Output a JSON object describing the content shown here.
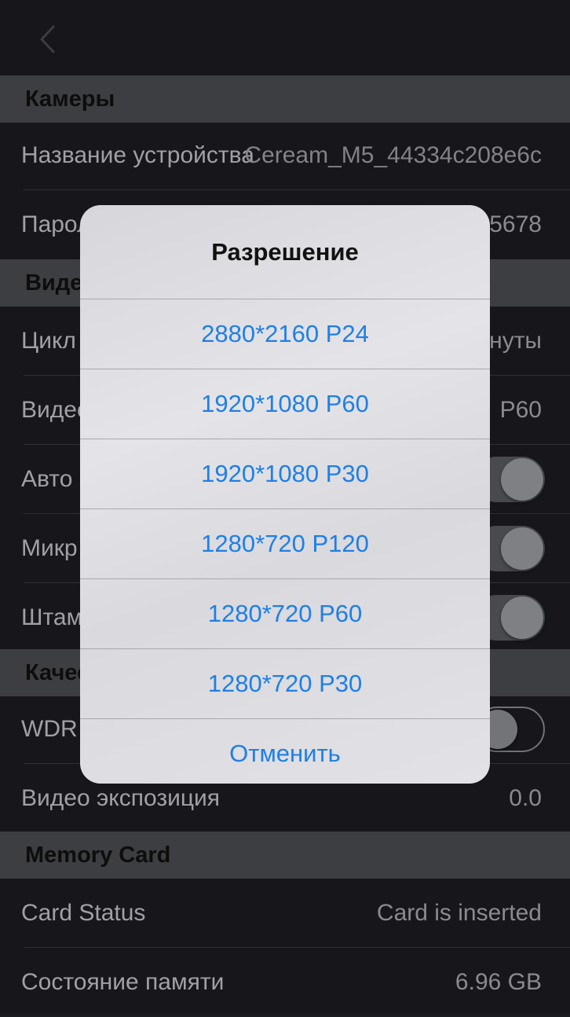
{
  "sections": {
    "camera": "Камеры",
    "video": "Видео",
    "quality": "Качество",
    "memory": "Memory Card"
  },
  "rows": {
    "device_name": {
      "label": "Название устройства",
      "value": "Ceream_M5_44334c208e6c"
    },
    "password": {
      "label": "Пароль",
      "value": "5678"
    },
    "loop": {
      "label": "Цикл",
      "value": "нуты"
    },
    "video_res": {
      "label": "Видео",
      "value": "P60"
    },
    "auto": {
      "label": "Авто"
    },
    "mic": {
      "label": "Микр"
    },
    "stamp": {
      "label": "Штам"
    },
    "wdr": {
      "label": "WDR"
    },
    "exposure": {
      "label": "Видео экспозиция",
      "value": "0.0"
    },
    "card_status": {
      "label": "Card Status",
      "value": "Card is inserted"
    },
    "memory_state": {
      "label": "Состояние памяти",
      "value": "6.96 GB"
    }
  },
  "dialog": {
    "title": "Разрешение",
    "options": [
      "2880*2160 P24",
      "1920*1080 P60",
      "1920*1080 P30",
      "1280*720 P120",
      "1280*720 P60",
      "1280*720 P30"
    ],
    "cancel": "Отменить"
  },
  "colors": {
    "accent": "#1f7fe6",
    "background": "#1b1c21",
    "section": "#4b4c51"
  },
  "icons": {
    "back": "chevron-left-icon"
  }
}
